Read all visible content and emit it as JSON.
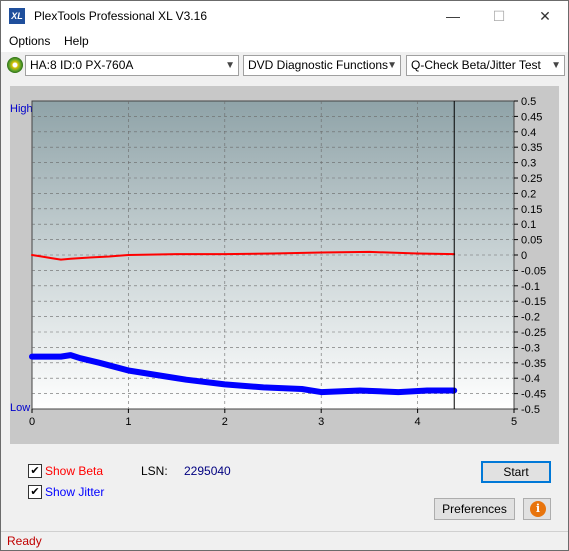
{
  "window": {
    "title": "PlexTools Professional XL V3.16",
    "icon_label": "XL",
    "controls": [
      "—",
      "☐",
      "✕"
    ]
  },
  "menu": {
    "items": [
      "Options",
      "Help"
    ]
  },
  "toolbar": {
    "drive": "HA:8 ID:0  PX-760A",
    "function": "DVD Diagnostic Functions",
    "test": "Q-Check Beta/Jitter Test"
  },
  "chart_data": {
    "type": "line",
    "y_left_labels": [
      "High",
      "Low"
    ],
    "x_ticks": [
      0,
      1,
      2,
      3,
      4,
      5
    ],
    "xlim": [
      0,
      5
    ],
    "ylim": [
      -0.5,
      0.5
    ],
    "y_ticks": [
      0.5,
      0.45,
      0.4,
      0.35,
      0.3,
      0.25,
      0.2,
      0.15,
      0.1,
      0.05,
      0,
      -0.05,
      -0.1,
      -0.15,
      -0.2,
      -0.25,
      -0.3,
      -0.35,
      -0.4,
      -0.45,
      -0.5
    ],
    "y_tick_labels": [
      "0.5",
      "0.45",
      "0.4",
      "0.35",
      "0.3",
      "0.25",
      "0.2",
      "0.15",
      "0.1",
      "0.05",
      "0",
      "-0.05",
      "-0.1",
      "-0.15",
      "-0.2",
      "-0.25",
      "-0.3",
      "-0.35",
      "-0.4",
      "-0.45",
      "-0.5"
    ],
    "grid": true,
    "end_marker_x": 4.38,
    "series": [
      {
        "color": "#ff0000",
        "x": [
          0,
          0.1,
          0.2,
          0.3,
          0.4,
          0.5,
          0.6,
          0.8,
          1.0,
          1.5,
          2.0,
          2.5,
          3.0,
          3.5,
          4.0,
          4.38
        ],
        "y": [
          0,
          -0.005,
          -0.01,
          -0.015,
          -0.012,
          -0.01,
          -0.008,
          -0.005,
          0.0,
          0.003,
          0.003,
          0.005,
          0.008,
          0.01,
          0.005,
          0.003
        ]
      },
      {
        "color": "#0000ff",
        "x": [
          0,
          0.1,
          0.2,
          0.3,
          0.4,
          0.5,
          0.7,
          1.0,
          1.3,
          1.6,
          2.0,
          2.4,
          2.8,
          3.0,
          3.4,
          3.8,
          4.1,
          4.38
        ],
        "y": [
          -0.33,
          -0.33,
          -0.33,
          -0.33,
          -0.325,
          -0.335,
          -0.35,
          -0.375,
          -0.39,
          -0.405,
          -0.42,
          -0.43,
          -0.435,
          -0.445,
          -0.44,
          -0.445,
          -0.44,
          -0.44
        ]
      }
    ]
  },
  "options": {
    "show_beta": {
      "label": "Show Beta",
      "checked": true,
      "color": "#ff0000"
    },
    "show_jitter": {
      "label": "Show Jitter",
      "checked": true,
      "color": "#0000ff"
    }
  },
  "lsn": {
    "label": "LSN:",
    "value": "2295040"
  },
  "buttons": {
    "start": "Start",
    "preferences": "Preferences",
    "info": "i"
  },
  "status": {
    "text": "Ready"
  }
}
